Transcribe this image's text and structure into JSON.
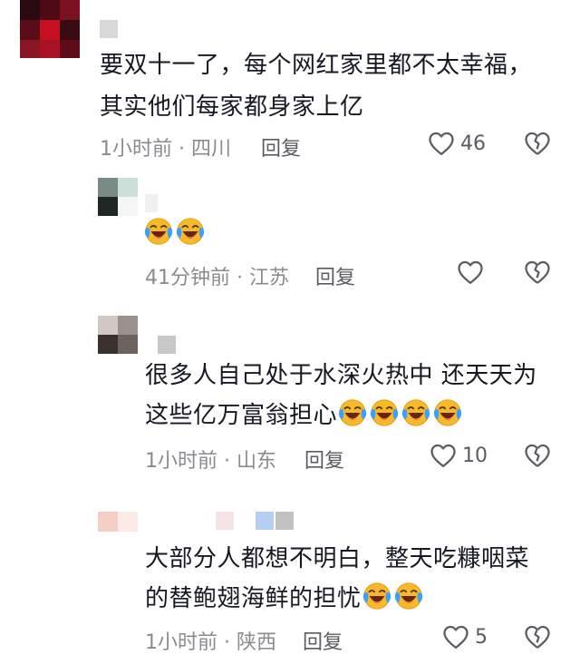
{
  "comments": [
    {
      "text_lines": [
        "要双十一了，每个网红家里都不太幸福，",
        "其实他们每家都身家上亿"
      ],
      "time": "1小时前",
      "location": "四川",
      "reply_label": "回复",
      "likes": "46"
    },
    {
      "text_lines": [
        ""
      ],
      "emoji_count": 2,
      "time": "41分钟前",
      "location": "江苏",
      "reply_label": "回复",
      "likes": ""
    },
    {
      "text_lines": [
        "很多人自己处于水深火热中 还天天为",
        "这些亿万富翁担心"
      ],
      "emoji_count": 4,
      "time": "1小时前",
      "location": "山东",
      "reply_label": "回复",
      "likes": "10"
    },
    {
      "text_lines": [
        "大部分人都想不明白，整天吃糠咽菜",
        "的替鲍翅海鲜的担忧"
      ],
      "emoji_count": 2,
      "time": "1小时前",
      "location": "陕西",
      "reply_label": "回复",
      "likes": "5"
    }
  ],
  "separator": " · ",
  "icons": {
    "like": "heart-outline-icon",
    "dislike": "broken-heart-icon",
    "emoji": "laughing-crying-emoji"
  },
  "colors": {
    "text": "#161823",
    "meta": "#8a8b91",
    "emoji_face": "#f7b928",
    "emoji_tears": "#3aa0ff"
  }
}
